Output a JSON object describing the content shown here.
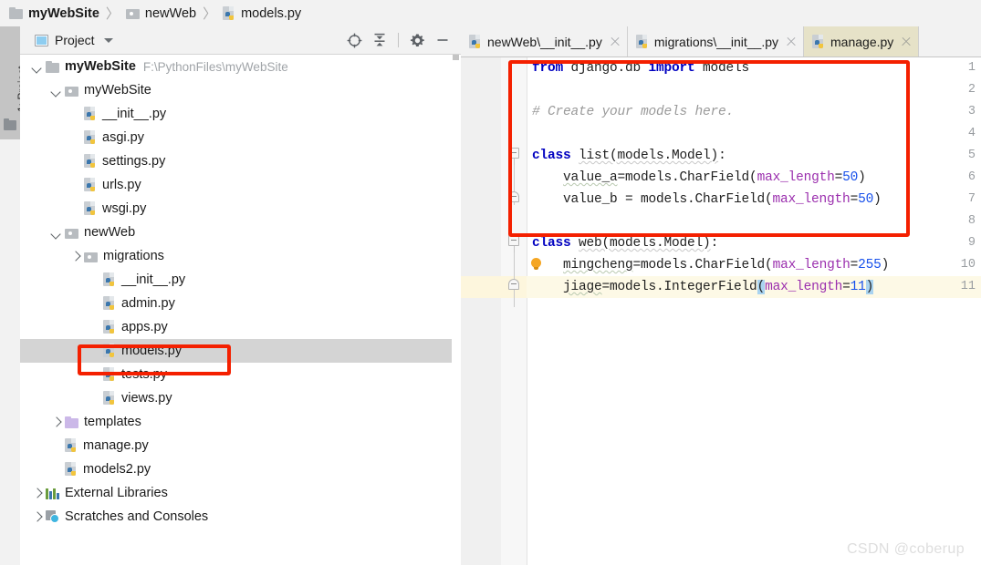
{
  "breadcrumb": {
    "items": [
      {
        "label": "myWebSite",
        "icon": "folder-icon",
        "bold": true
      },
      {
        "label": "newWeb",
        "icon": "module-folder-icon",
        "bold": false
      },
      {
        "label": "models.py",
        "icon": "python-file-icon",
        "bold": false
      }
    ],
    "separator": "〉"
  },
  "toolstrip": {
    "project_button_label": "1: Project"
  },
  "project_panel": {
    "title": "Project",
    "tools": [
      {
        "name": "locate-icon",
        "title": "Select Opened File"
      },
      {
        "name": "collapse-all-icon",
        "title": "Collapse All"
      },
      {
        "name": "gear-icon",
        "title": "Settings"
      },
      {
        "name": "minimize-icon",
        "title": "Hide"
      }
    ],
    "tree": [
      {
        "label": "myWebSite",
        "path": "F:\\PythonFiles\\myWebSite",
        "icon": "folder-icon",
        "arrow": "down",
        "indent": 0,
        "bold": true,
        "selected": false
      },
      {
        "label": "myWebSite",
        "path": "",
        "icon": "module-folder-icon",
        "arrow": "down",
        "indent": 1,
        "bold": false,
        "selected": false
      },
      {
        "label": "__init__.py",
        "path": "",
        "icon": "python-file-icon",
        "arrow": "none",
        "indent": 2,
        "bold": false,
        "selected": false
      },
      {
        "label": "asgi.py",
        "path": "",
        "icon": "python-file-icon",
        "arrow": "none",
        "indent": 2,
        "bold": false,
        "selected": false
      },
      {
        "label": "settings.py",
        "path": "",
        "icon": "python-file-icon",
        "arrow": "none",
        "indent": 2,
        "bold": false,
        "selected": false
      },
      {
        "label": "urls.py",
        "path": "",
        "icon": "python-file-icon",
        "arrow": "none",
        "indent": 2,
        "bold": false,
        "selected": false
      },
      {
        "label": "wsgi.py",
        "path": "",
        "icon": "python-file-icon",
        "arrow": "none",
        "indent": 2,
        "bold": false,
        "selected": false
      },
      {
        "label": "newWeb",
        "path": "",
        "icon": "module-folder-icon",
        "arrow": "down",
        "indent": 1,
        "bold": false,
        "selected": false
      },
      {
        "label": "migrations",
        "path": "",
        "icon": "module-folder-icon",
        "arrow": "right",
        "indent": 2,
        "bold": false,
        "selected": false
      },
      {
        "label": "__init__.py",
        "path": "",
        "icon": "python-file-icon",
        "arrow": "none",
        "indent": 3,
        "bold": false,
        "selected": false
      },
      {
        "label": "admin.py",
        "path": "",
        "icon": "python-file-icon",
        "arrow": "none",
        "indent": 3,
        "bold": false,
        "selected": false
      },
      {
        "label": "apps.py",
        "path": "",
        "icon": "python-file-icon",
        "arrow": "none",
        "indent": 3,
        "bold": false,
        "selected": false
      },
      {
        "label": "models.py",
        "path": "",
        "icon": "python-file-icon",
        "arrow": "none",
        "indent": 3,
        "bold": false,
        "selected": true
      },
      {
        "label": "tests.py",
        "path": "",
        "icon": "python-file-icon",
        "arrow": "none",
        "indent": 3,
        "bold": false,
        "selected": false
      },
      {
        "label": "views.py",
        "path": "",
        "icon": "python-file-icon",
        "arrow": "none",
        "indent": 3,
        "bold": false,
        "selected": false
      },
      {
        "label": "templates",
        "path": "",
        "icon": "templates-folder-icon",
        "arrow": "right",
        "indent": 1,
        "bold": false,
        "selected": false
      },
      {
        "label": "manage.py",
        "path": "",
        "icon": "python-file-icon",
        "arrow": "none",
        "indent": 1,
        "bold": false,
        "selected": false
      },
      {
        "label": "models2.py",
        "path": "",
        "icon": "python-file-icon",
        "arrow": "none",
        "indent": 1,
        "bold": false,
        "selected": false
      },
      {
        "label": "External Libraries",
        "path": "",
        "icon": "external-libraries-icon",
        "arrow": "right",
        "indent": 0,
        "bold": false,
        "selected": false
      },
      {
        "label": "Scratches and Consoles",
        "path": "",
        "icon": "scratches-icon",
        "arrow": "right",
        "indent": 0,
        "bold": false,
        "selected": false
      }
    ]
  },
  "editor": {
    "tabs": [
      {
        "label": "newWeb\\__init__.py",
        "icon": "python-file-icon",
        "active": false,
        "close": "close-icon"
      },
      {
        "label": "migrations\\__init__.py",
        "icon": "python-file-icon",
        "active": false,
        "close": "close-icon"
      },
      {
        "label": "manage.py",
        "icon": "python-file-icon",
        "active": true,
        "close": "close-icon"
      }
    ],
    "line_numbers": [
      "1",
      "2",
      "3",
      "4",
      "5",
      "6",
      "7",
      "8",
      "9",
      "10",
      "11"
    ],
    "code": [
      {
        "n": 1,
        "text": "from django.db import models"
      },
      {
        "n": 2,
        "text": ""
      },
      {
        "n": 3,
        "text": "# Create your models here."
      },
      {
        "n": 4,
        "text": ""
      },
      {
        "n": 5,
        "text": "class list(models.Model):"
      },
      {
        "n": 6,
        "text": "    value_a=models.CharField(max_length=50)"
      },
      {
        "n": 7,
        "text": "    value_b = models.CharField(max_length=50)"
      },
      {
        "n": 8,
        "text": ""
      },
      {
        "n": 9,
        "text": "class web(models.Model):"
      },
      {
        "n": 10,
        "text": "    mingcheng=models.CharField(max_length=255)"
      },
      {
        "n": 11,
        "text": "    jiage=models.IntegerField(max_length=11)"
      }
    ],
    "caret_line": 11,
    "intention_line": 10,
    "intention_icon": "lightbulb-icon"
  },
  "annotations": [
    {
      "name": "tree-highlight-box",
      "color": "#f42000"
    },
    {
      "name": "code-highlight-box",
      "color": "#f42000"
    }
  ],
  "watermark": "CSDN @coberup",
  "colors": {
    "keyword": "#0000c0",
    "comment": "#9a9a9a",
    "kwarg": "#9b2fae",
    "number": "#1750eb",
    "annotation": "#f42000",
    "active_tab": "#e6e2c8",
    "selection": "#d4d4d4"
  }
}
